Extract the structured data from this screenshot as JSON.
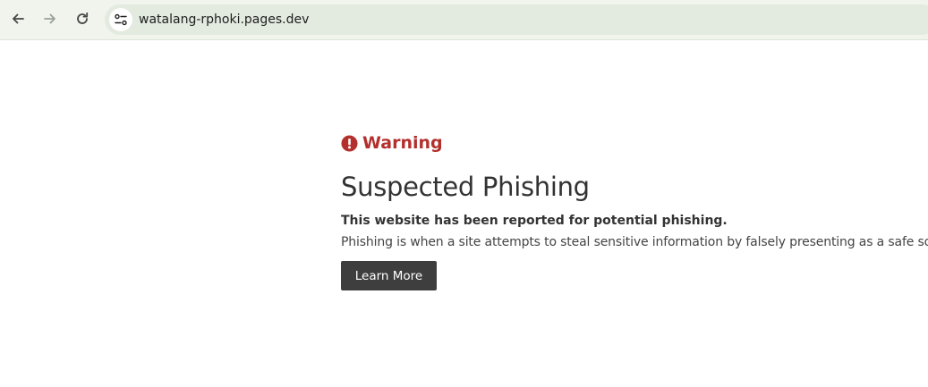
{
  "browser": {
    "url": "watalang-rphoki.pages.dev",
    "toolbar_color": "#f0f4ec",
    "icons": {
      "back": "back-arrow-icon",
      "forward": "forward-arrow-icon",
      "reload": "reload-icon",
      "site_info": "tune-icon"
    }
  },
  "page": {
    "warning_label": "Warning",
    "warning_color": "#b3302d",
    "headline": "Suspected Phishing",
    "subheading": "This website has been reported for potential phishing.",
    "description": "Phishing is when a site attempts to steal sensitive information by falsely presenting as a safe source.",
    "learn_more_button": "Learn More",
    "button_color": "#3e3e3e"
  }
}
